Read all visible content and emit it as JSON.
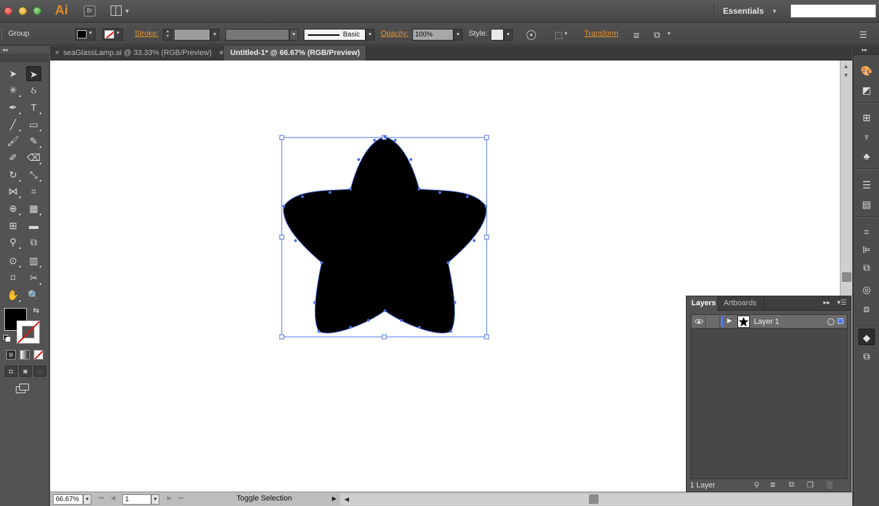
{
  "app": {
    "logo": "Ai",
    "bridge_label": "Br",
    "workspace": "Essentials",
    "search_placeholder": ""
  },
  "control": {
    "selection_type": "Group",
    "stroke_label": "Stroke:",
    "brush_label": "Basic",
    "opacity_label": "Opacity:",
    "opacity_value": "100%",
    "style_label": "Style:",
    "transform_label": "Transform",
    "fill_color": "#000000",
    "stroke_color": "none"
  },
  "tabs": [
    {
      "label": "seaGlassLamp.ai @ 33.33% (RGB/Preview)",
      "active": false
    },
    {
      "label": "Untitled-1* @ 66.67% (RGB/Preview)",
      "active": true
    }
  ],
  "status": {
    "zoom": "66.67%",
    "artboard": "1",
    "info": "Toggle Selection"
  },
  "layers_panel": {
    "tabs": [
      "Layers",
      "Artboards"
    ],
    "layers": [
      {
        "name": "Layer 1",
        "visible": true,
        "color": "#4b78ff"
      }
    ],
    "count_label": "1 Layer"
  },
  "colors": {
    "selection": "#4a6fe3",
    "accent_orange": "#e8922e"
  }
}
